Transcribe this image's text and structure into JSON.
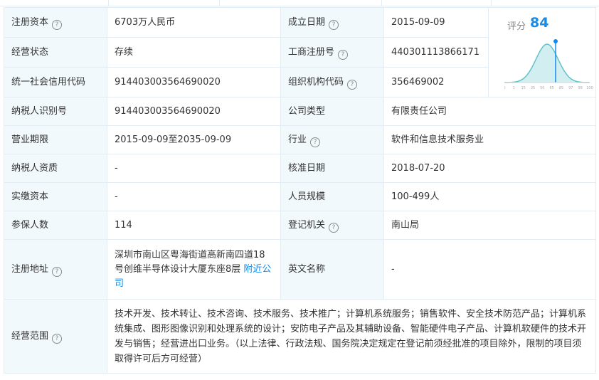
{
  "rows": [
    {
      "l1": "注册资本",
      "v1": "6703万人民币",
      "l2": "成立日期",
      "v2": "2015-09-09"
    },
    {
      "l1": "经营状态",
      "v1": "存续",
      "l2": "工商注册号",
      "v2": "440301113866171"
    },
    {
      "l1": "统一社会信用代码",
      "v1": "914403003564690020",
      "l2": "组织机构代码",
      "v2": "356469002"
    },
    {
      "l1": "纳税人识别号",
      "v1": "914403003564690020",
      "l2": "公司类型",
      "v2": "有限责任公司"
    },
    {
      "l1": "营业期限",
      "v1": "2015-09-09至2035-09-09",
      "l2": "行业",
      "v2": "软件和信息技术服务业"
    },
    {
      "l1": "纳税人资质",
      "v1": "-",
      "l2": "核准日期",
      "v2": "2018-07-20"
    },
    {
      "l1": "实缴资本",
      "v1": "-",
      "l2": "人员规模",
      "v2": "100-499人"
    },
    {
      "l1": "参保人数",
      "v1": "114",
      "l2": "登记机关",
      "v2": "南山局"
    },
    {
      "l1": "注册地址",
      "v1": "深圳市南山区粤海街道高新南四道18号创维半导体设计大厦东座8层",
      "v1_link": "附近公司",
      "l2": "英文名称",
      "v2": "-"
    },
    {
      "l1": "经营范围",
      "v1": "技术开发、技术转让、技术咨询、技术服务、技术推广；计算机系统服务；销售软件、安全技术防范产品；计算机系统集成、图形图像识别和处理系统的设计；安防电子产品及其辅助设备、智能硬件电子产品、计算机软硬件的技术开发与销售；经营进出口业务。（以上法律、行政法规、国务院决定规定在登记前须经批准的项目除外，限制的项目须取得许可后方可经营）"
    }
  ],
  "help_icon": "?",
  "score": {
    "label": "评分",
    "value": 84,
    "axis_ticks": [
      "0",
      "1",
      "15",
      "35",
      "50",
      "65",
      "85",
      "97",
      "99",
      "100"
    ],
    "colors": {
      "accent": "#128bed",
      "curve": "#5fc2c9",
      "fill": "#d3eef0"
    }
  }
}
